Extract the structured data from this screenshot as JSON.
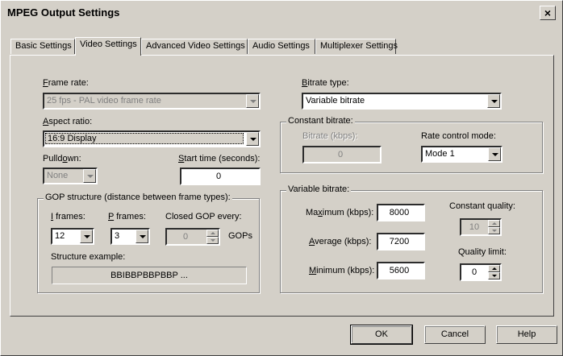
{
  "window": {
    "title": "MPEG Output Settings",
    "close_glyph": "×"
  },
  "tabs": [
    {
      "label": "Basic Settings"
    },
    {
      "label": "Video Settings"
    },
    {
      "label": "Advanced Video Settings"
    },
    {
      "label": "Audio Settings"
    },
    {
      "label": "Multiplexer Settings"
    }
  ],
  "left": {
    "frame_rate": {
      "label_pre": "",
      "label_u": "F",
      "label_post": "rame rate:",
      "value": "25 fps - PAL video frame rate"
    },
    "aspect_ratio": {
      "label_pre": "",
      "label_u": "A",
      "label_post": "spect ratio:",
      "value": "16:9 Display"
    },
    "pulldown": {
      "label_pre": "Pulld",
      "label_u": "o",
      "label_post": "wn:",
      "value": "None"
    },
    "start_time": {
      "label_pre": "",
      "label_u": "S",
      "label_post": "tart time (seconds):",
      "value": "0"
    },
    "gop": {
      "title": "GOP structure (distance between frame types):",
      "i_frames": {
        "label_pre": "",
        "label_u": "I",
        "label_post": " frames:",
        "value": "12"
      },
      "p_frames": {
        "label_pre": "",
        "label_u": "P",
        "label_post": " frames:",
        "value": "3"
      },
      "closed_gop": {
        "label": "Closed GOP every:",
        "value": "0",
        "suffix": "GOPs"
      },
      "structure_label": "Structure example:",
      "structure_value": "BBIBBPBBPBBP ..."
    }
  },
  "right": {
    "bitrate_type": {
      "label_pre": "",
      "label_u": "B",
      "label_post": "itrate type:",
      "value": "Variable bitrate"
    },
    "constant": {
      "title": "Constant bitrate:",
      "bitrate_label": "Bitrate (kbps):",
      "bitrate_value": "0",
      "rate_mode_label": "Rate control mode:",
      "rate_mode_value": "Mode 1"
    },
    "variable": {
      "title": "Variable bitrate:",
      "maximum": {
        "label_pre": "Ma",
        "label_u": "x",
        "label_post": "imum (kbps):",
        "value": "8000"
      },
      "average": {
        "label_pre": "",
        "label_u": "A",
        "label_post": "verage (kbps):",
        "value": "7200"
      },
      "minimum": {
        "label_pre": "",
        "label_u": "M",
        "label_post": "inimum (kbps):",
        "value": "5600"
      },
      "constant_quality": {
        "label": "Constant quality:",
        "value": "10"
      },
      "quality_limit": {
        "label": "Quality limit:",
        "value": "0"
      }
    }
  },
  "buttons": {
    "ok": "OK",
    "cancel": "Cancel",
    "help": "Help"
  }
}
